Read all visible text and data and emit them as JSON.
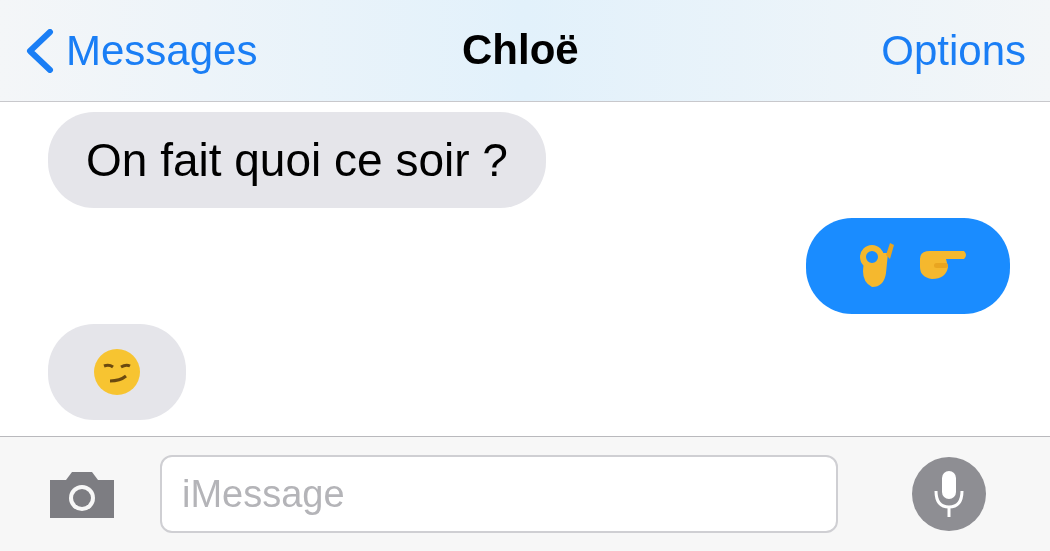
{
  "header": {
    "back_label": "Messages",
    "title": "Chloë",
    "action": "Options"
  },
  "messages": [
    {
      "kind": "incoming",
      "text": "On fait quoi ce soir ?"
    },
    {
      "kind": "outgoing",
      "emoji": [
        {
          "kind": "ok_hand"
        },
        {
          "kind": "pointing_right"
        }
      ]
    },
    {
      "kind": "incoming",
      "emoji": [
        {
          "kind": "smirk"
        }
      ]
    }
  ],
  "composer": {
    "placeholder": "iMessage"
  }
}
